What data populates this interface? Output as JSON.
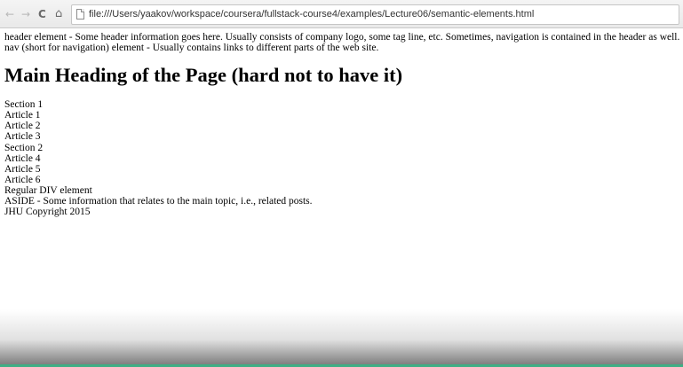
{
  "browser": {
    "back_icon": "back-arrow-icon",
    "forward_icon": "forward-arrow-icon",
    "reload_icon": "reload-icon",
    "home_icon": "home-icon",
    "page_icon": "page-icon",
    "url": "file:///Users/yaakov/workspace/coursera/fullstack-course4/examples/Lecture06/semantic-elements.html"
  },
  "page": {
    "header_text": "header element - Some header information goes here. Usually consists of company logo, some tag line, etc. Sometimes, navigation is contained in the header as well.",
    "nav_text": "nav (short for navigation) element - Usually contains links to different parts of the web site.",
    "heading": "Main Heading of the Page (hard not to have it)",
    "lines": [
      "Section 1",
      "Article 1",
      "Article 2",
      "Article 3",
      "Section 2",
      "Article 4",
      "Article 5",
      "Article 6",
      "Regular DIV element",
      "ASIDE - Some information that relates to the main topic, i.e., related posts.",
      "JHU Copyright 2015"
    ]
  },
  "colors": {
    "accent_bar": "#3fae84"
  }
}
